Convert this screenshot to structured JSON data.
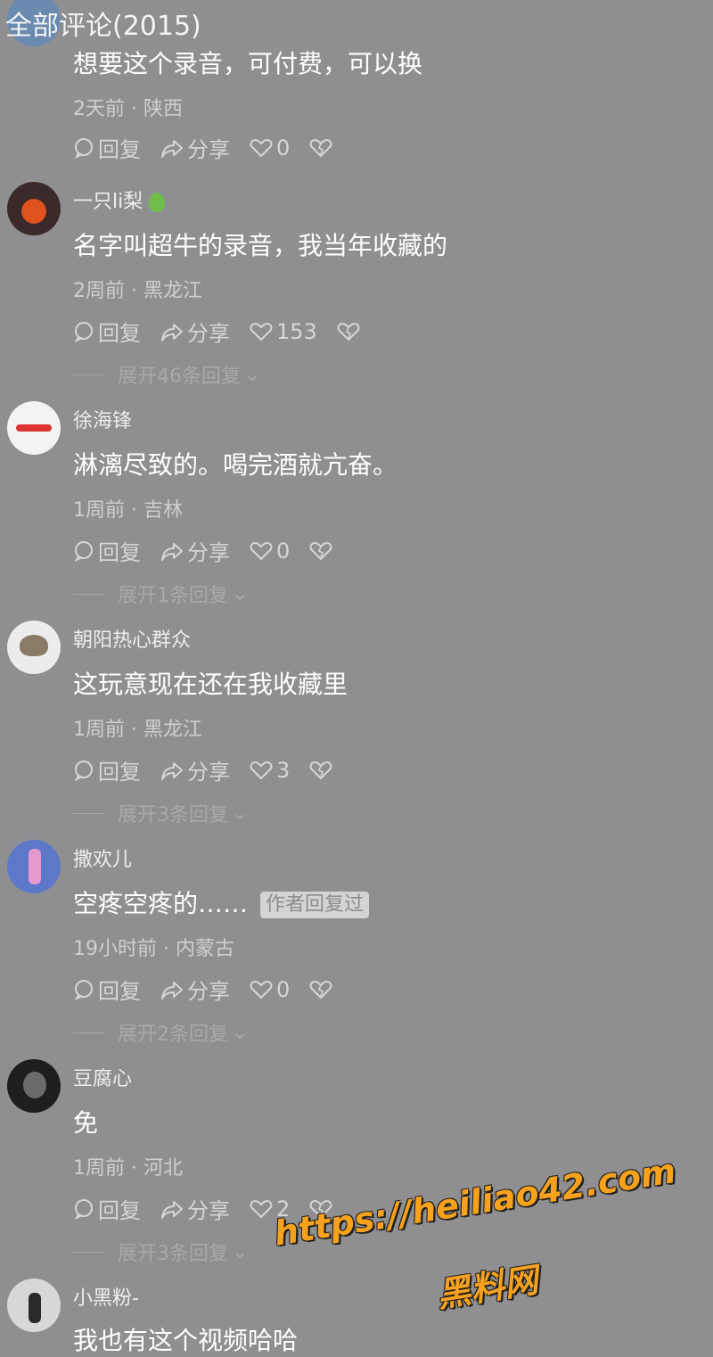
{
  "header": {
    "title": "全部评论(2015)"
  },
  "actions": {
    "reply": "回复",
    "share": "分享"
  },
  "comments": [
    {
      "user": "",
      "text": "想要这个录音，可付费，可以换",
      "meta": "2天前 · 陕西",
      "likes": "0",
      "expand": ""
    },
    {
      "user": "一只li梨",
      "text": "名字叫超牛的录音，我当年收藏的",
      "meta": "2周前 · 黑龙江",
      "likes": "153",
      "expand": "展开46条回复"
    },
    {
      "user": "徐海锋",
      "text": "淋漓尽致的。喝完酒就亢奋。",
      "meta": "1周前 · 吉林",
      "likes": "0",
      "expand": "展开1条回复"
    },
    {
      "user": "朝阳热心群众",
      "text": "这玩意现在还在我收藏里",
      "meta": "1周前 · 黑龙江",
      "likes": "3",
      "expand": "展开3条回复"
    },
    {
      "user": "撒欢儿",
      "text": "空疼空疼的……",
      "badge": "作者回复过",
      "meta": "19小时前 · 内蒙古",
      "likes": "0",
      "expand": "展开2条回复"
    },
    {
      "user": "豆腐心",
      "text": "免",
      "meta": "1周前 · 河北",
      "likes": "2",
      "expand": "展开3条回复"
    },
    {
      "user": "小黑粉-",
      "text": "我也有这个视频哈哈",
      "meta": "",
      "likes": "",
      "expand": ""
    }
  ],
  "watermark": {
    "url": "https://heiliao42.com",
    "name": "黑料网"
  }
}
